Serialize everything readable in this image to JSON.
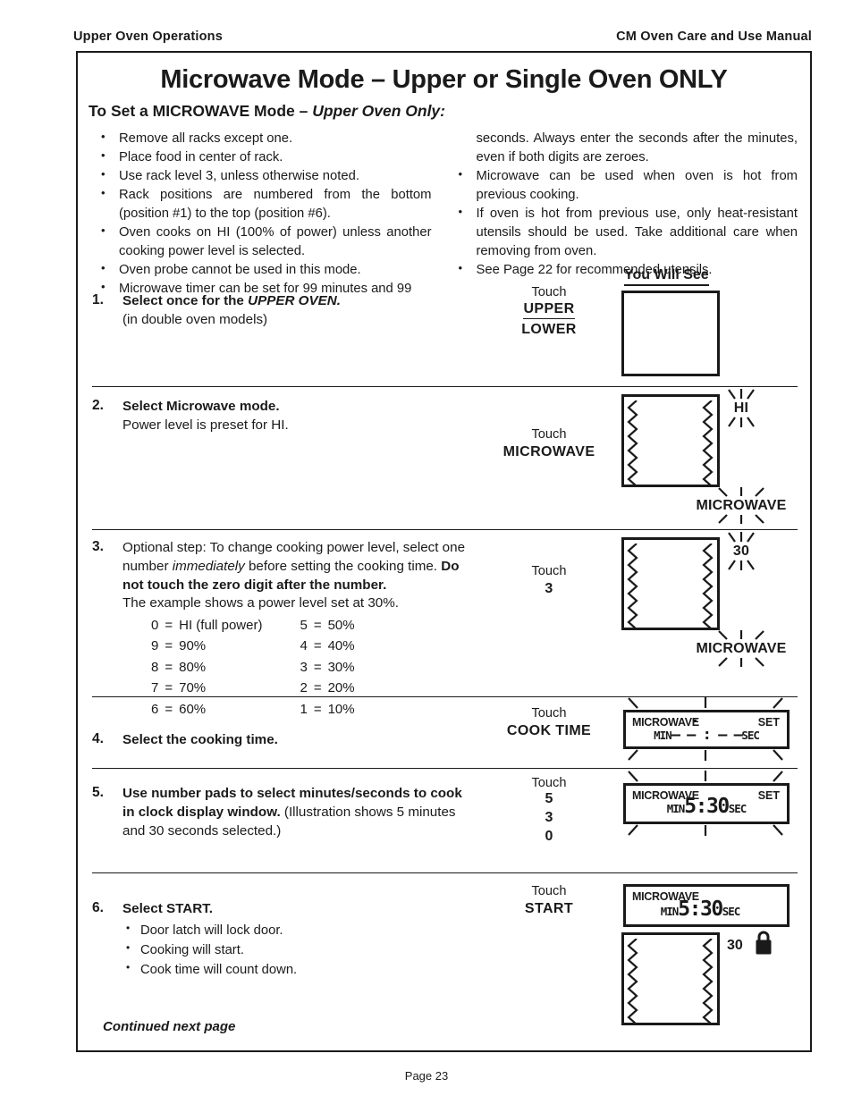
{
  "running_header": {
    "left": "Upper Oven Operations",
    "right": "CM Oven Care and Use Manual"
  },
  "title": "Microwave Mode – Upper or Single Oven ONLY",
  "subtitle": {
    "lead": "To Set a MICROWAVE Mode – ",
    "italic": "Upper Oven Only:"
  },
  "intro_left": [
    "Remove all racks except one.",
    "Place food in center of rack.",
    "Use rack level 3, unless otherwise noted.",
    "Rack positions are numbered from the bottom (position #1) to the top (position #6).",
    "Oven cooks on HI (100% of power) unless another cooking power level is selected.",
    "Oven probe cannot be used in this mode.",
    "Microwave timer can be set for 99 minutes and 99"
  ],
  "intro_right_cont": "seconds. Always enter the seconds after the minutes, even if both digits are zeroes.",
  "intro_right": [
    "Microwave can be used when oven is hot from previous cooking.",
    "If oven is hot from previous use, only heat-resistant utensils should be used. Take additional care when removing from oven.",
    "See Page 22 for recommended utensils."
  ],
  "you_will_see_label": "You Will See",
  "steps": [
    {
      "num": "1.",
      "bold_lead": "Select once for the ",
      "bold_italic": "UPPER OVEN.",
      "sub": "(in double oven models)",
      "touch_word": "Touch",
      "touch_keys": [
        "UPPER",
        "LOWER"
      ]
    },
    {
      "num": "2.",
      "bold_lead": "Select Microwave mode.",
      "sub": "Power level is preset for HI.",
      "touch_word": "Touch",
      "touch_keys": [
        "MICROWAVE"
      ],
      "display_power": "HI",
      "display_mode": "MICROWAVE"
    },
    {
      "num": "3.",
      "para_1": "Optional step: To change cooking power level,  select one number ",
      "para_1_italic": "immediately",
      "para_1_cont": " before setting the cooking time. ",
      "para_1_bold": "Do not touch the zero digit after the number.",
      "para_2": "The example shows a power level set at 30%.",
      "power_table": [
        {
          "key": "0",
          "val": "HI (full power)",
          "key2": "5",
          "val2": "50%"
        },
        {
          "key": "9",
          "val": "90%",
          "key2": "4",
          "val2": "40%"
        },
        {
          "key": "8",
          "val": "80%",
          "key2": "3",
          "val2": "30%"
        },
        {
          "key": "7",
          "val": "70%",
          "key2": "2",
          "val2": "20%"
        },
        {
          "key": "6",
          "val": "60%",
          "key2": "1",
          "val2": "10%"
        }
      ],
      "touch_word": "Touch",
      "touch_keys": [
        "3"
      ],
      "display_power": "30",
      "display_mode": "MICROWAVE"
    },
    {
      "num": "4.",
      "bold_lead": "Select the cooking time.",
      "touch_word": "Touch",
      "touch_keys": [
        "COOK TIME"
      ],
      "lcd": {
        "mw": "MICROWAVE",
        "set": "SET",
        "min": "MIN",
        "time": "– – : – –",
        "sec": "SEC"
      }
    },
    {
      "num": "5.",
      "bold_lead": "Use number pads to select minutes/seconds to cook in clock display window. ",
      "normal_tail": "(Illustration shows 5 minutes and 30 seconds selected.)",
      "touch_word": "Touch",
      "touch_keys": [
        "5",
        "3",
        "0"
      ],
      "lcd": {
        "mw": "MICROWAVE",
        "set": "SET",
        "min": "MIN",
        "time": "5:30",
        "sec": "SEC"
      }
    },
    {
      "num": "6.",
      "bold_lead": "Select START.",
      "sub_bullets": [
        "Door latch will lock door.",
        "Cooking will start.",
        "Cook time will count down."
      ],
      "touch_word": "Touch",
      "touch_keys": [
        "START"
      ],
      "lcd": {
        "mw": "MICROWAVE",
        "min": "MIN",
        "time": "5:30",
        "sec": "SEC"
      },
      "oven_power": "30",
      "lock_icon": "padlock-icon"
    }
  ],
  "continued": "Continued next page",
  "page_footer": "Page 23",
  "colors": {
    "ink": "#1a1a1a",
    "paper": "#ffffff"
  }
}
